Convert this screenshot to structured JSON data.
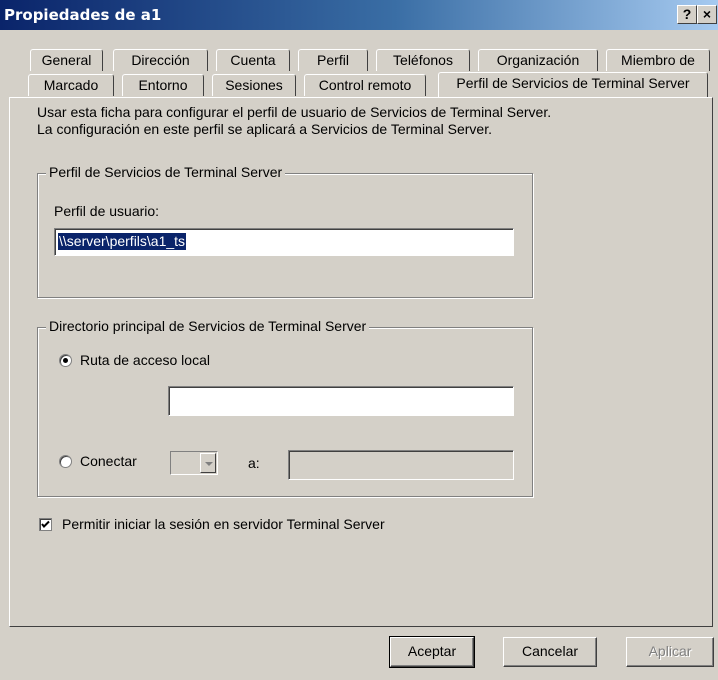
{
  "window": {
    "title": "Propiedades de a1",
    "help_label": "?",
    "close_label": "×"
  },
  "tabs_row1": [
    {
      "label": "General"
    },
    {
      "label": "Dirección"
    },
    {
      "label": "Cuenta"
    },
    {
      "label": "Perfil"
    },
    {
      "label": "Teléfonos"
    },
    {
      "label": "Organización"
    },
    {
      "label": "Miembro de"
    }
  ],
  "tabs_row2": [
    {
      "label": "Marcado"
    },
    {
      "label": "Entorno"
    },
    {
      "label": "Sesiones"
    },
    {
      "label": "Control remoto"
    },
    {
      "label": "Perfil de Servicios de Terminal Server",
      "active": true
    }
  ],
  "intro": "Usar esta ficha para configurar el perfil de usuario de Servicios de Terminal Server. La configuración en este perfil se aplicará a Servicios de Terminal Server.",
  "profile_group": {
    "legend": "Perfil de Servicios de Terminal Server",
    "user_profile_label": "Perfil de usuario:",
    "user_profile_value": "\\\\server\\perfils\\a1_ts"
  },
  "home_group": {
    "legend": "Directorio principal de Servicios de Terminal Server",
    "local_path_label": "Ruta de acceso local",
    "local_path_selected": true,
    "local_path_value": "",
    "connect_label": "Conectar",
    "connect_selected": false,
    "drive_value": "",
    "to_label": "a:",
    "to_value": ""
  },
  "allow_logon": {
    "label": "Permitir iniciar la sesión en servidor Terminal Server",
    "checked": true
  },
  "buttons": {
    "ok": "Aceptar",
    "cancel": "Cancelar",
    "apply": "Aplicar"
  }
}
